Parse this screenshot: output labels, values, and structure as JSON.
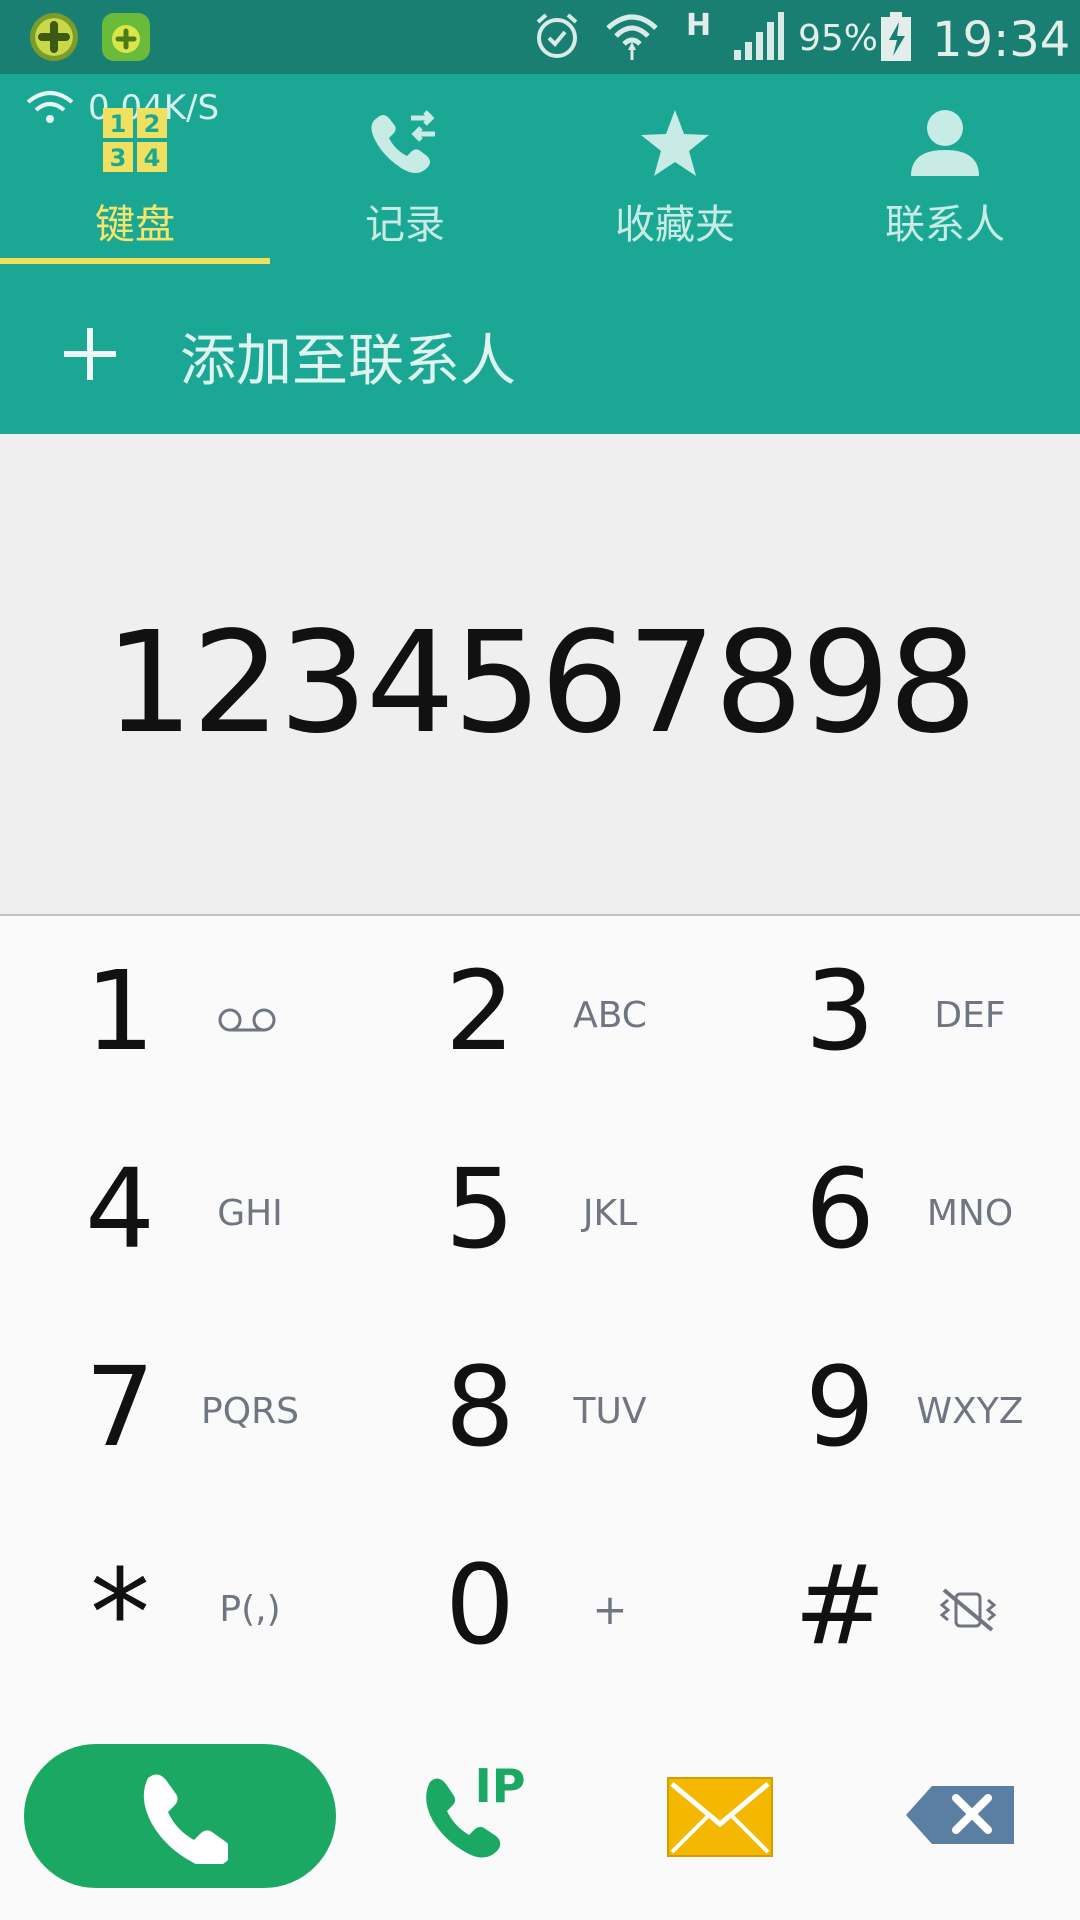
{
  "status_bar": {
    "battery_percent": "95%",
    "time": "19:34",
    "network_type": "H",
    "icons": [
      "app-icon-360",
      "app-icon-360-security",
      "alarm-icon",
      "wifi-icon",
      "signal-icon",
      "battery-charging-icon"
    ]
  },
  "net_speed": "0.04K/S",
  "tabs": [
    {
      "label": "键盘",
      "icon": "keypad-icon",
      "active": true
    },
    {
      "label": "记录",
      "icon": "call-log-icon",
      "active": false
    },
    {
      "label": "收藏夹",
      "icon": "star-icon",
      "active": false
    },
    {
      "label": "联系人",
      "icon": "person-icon",
      "active": false
    }
  ],
  "add_contact": {
    "label": "添加至联系人"
  },
  "dialed_number": "1234567898",
  "keys": [
    {
      "digit": "1",
      "letters": "",
      "sub_icon": "voicemail-icon"
    },
    {
      "digit": "2",
      "letters": "ABC"
    },
    {
      "digit": "3",
      "letters": "DEF"
    },
    {
      "digit": "4",
      "letters": "GHI"
    },
    {
      "digit": "5",
      "letters": "JKL"
    },
    {
      "digit": "6",
      "letters": "MNO"
    },
    {
      "digit": "7",
      "letters": "PQRS"
    },
    {
      "digit": "8",
      "letters": "TUV"
    },
    {
      "digit": "9",
      "letters": "WXYZ"
    },
    {
      "digit": "*",
      "letters": "P(,)"
    },
    {
      "digit": "0",
      "letters": "+"
    },
    {
      "digit": "#",
      "letters": "",
      "sub_icon": "vibrate-mute-icon"
    }
  ],
  "actions": {
    "ip_label": "IP",
    "icons": [
      "call-icon",
      "ip-call-icon",
      "message-icon",
      "backspace-icon"
    ]
  },
  "colors": {
    "status_bar": "#187f72",
    "header": "#1aa895",
    "active_tab": "#f2df5b",
    "call_button": "#1aa862",
    "message_icon": "#f5b800",
    "backspace_icon": "#5b7ea3"
  }
}
